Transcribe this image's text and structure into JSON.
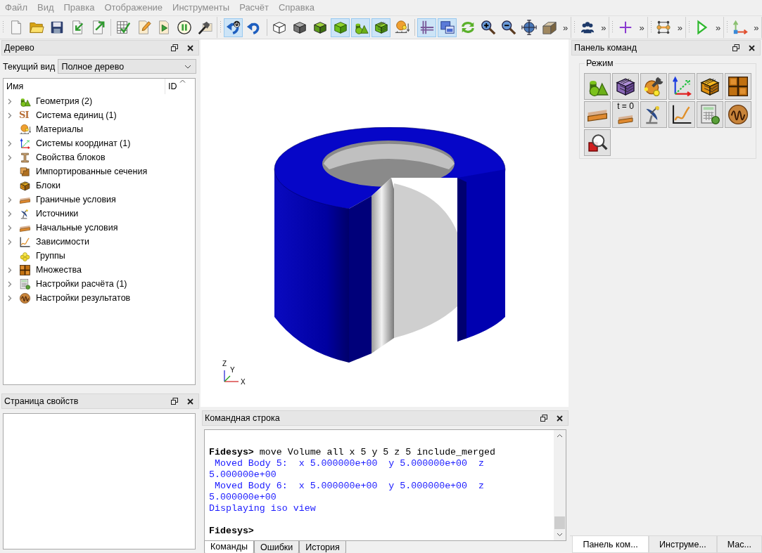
{
  "menu": [
    "Файл",
    "Вид",
    "Правка",
    "Отображение",
    "Инструменты",
    "Расчёт",
    "Справка"
  ],
  "toolbars": [
    {
      "sections": [
        [
          {
            "kind": "new",
            "pressed": false
          },
          {
            "kind": "open",
            "pressed": false
          },
          {
            "kind": "save",
            "pressed": false
          },
          {
            "kind": "import",
            "pressed": false
          },
          {
            "kind": "export",
            "pressed": false
          }
        ],
        [
          {
            "kind": "table",
            "pressed": false
          },
          {
            "kind": "edit",
            "pressed": false
          },
          {
            "kind": "run",
            "pressed": false
          },
          {
            "kind": "pause",
            "pressed": false
          },
          {
            "kind": "hammer",
            "pressed": false
          }
        ]
      ]
    },
    {
      "sections": [
        [
          {
            "kind": "reset",
            "pressed": true
          },
          {
            "kind": "undo",
            "pressed": false
          }
        ],
        [
          {
            "kind": "wireframe",
            "pressed": false
          },
          {
            "kind": "solid",
            "pressed": false
          },
          {
            "kind": "edges",
            "pressed": false
          },
          {
            "kind": "greencube",
            "pressed": true
          },
          {
            "kind": "shapes",
            "pressed": true
          },
          {
            "kind": "mesh",
            "pressed": true
          },
          {
            "kind": "material",
            "pressed": false
          }
        ],
        [
          {
            "kind": "grid",
            "pressed": true
          },
          {
            "kind": "windows",
            "pressed": true
          },
          {
            "kind": "refresh",
            "pressed": false
          },
          {
            "kind": "zoomin",
            "pressed": false
          },
          {
            "kind": "zoomout",
            "pressed": false
          },
          {
            "kind": "center",
            "pressed": false
          },
          {
            "kind": "box",
            "pressed": false
          }
        ]
      ],
      "overflow": "»"
    },
    {
      "sections": [
        [
          {
            "kind": "people",
            "pressed": false
          }
        ]
      ],
      "overflow": "»"
    },
    {
      "sections": [
        [
          {
            "kind": "plus",
            "pressed": false
          }
        ]
      ],
      "overflow": "»"
    },
    {
      "sections": [
        [
          {
            "kind": "nodes",
            "pressed": false
          }
        ]
      ],
      "overflow": "»"
    },
    {
      "sections": [
        [
          {
            "kind": "play",
            "pressed": false
          }
        ]
      ],
      "overflow": "»"
    },
    {
      "sections": [
        [
          {
            "kind": "axes",
            "pressed": false
          }
        ]
      ],
      "overflow": "»"
    }
  ],
  "tree_panel": {
    "title": "Дерево",
    "view_label": "Текущий вид",
    "view_value": "Полное дерево",
    "columns": [
      "Имя",
      "ID"
    ],
    "items": [
      {
        "label": "Геометрия (2)",
        "kind": "shapes",
        "expandable": true
      },
      {
        "label": "Система единиц (1)",
        "kind": "units",
        "icon_text": "SI",
        "expandable": true
      },
      {
        "label": "Материалы",
        "kind": "material",
        "expandable": false
      },
      {
        "label": "Системы координат (1)",
        "kind": "coords",
        "expandable": true
      },
      {
        "label": "Свойства блоков",
        "kind": "beam",
        "expandable": true
      },
      {
        "label": "Импортированные сечения",
        "kind": "section",
        "expandable": false
      },
      {
        "label": "Блоки",
        "kind": "blocks",
        "expandable": false
      },
      {
        "label": "Граничные условия",
        "kind": "strip",
        "expandable": true
      },
      {
        "label": "Источники",
        "kind": "dish",
        "expandable": true
      },
      {
        "label": "Начальные условия",
        "kind": "initial",
        "expandable": true
      },
      {
        "label": "Зависимости",
        "kind": "graph",
        "expandable": true
      },
      {
        "label": "Группы",
        "kind": "groups",
        "expandable": false
      },
      {
        "label": "Множества",
        "kind": "sets",
        "expandable": true
      },
      {
        "label": "Настройки расчёта (1)",
        "kind": "calc",
        "expandable": true
      },
      {
        "label": "Настройки результатов",
        "kind": "results",
        "expandable": true
      }
    ]
  },
  "properties_panel": {
    "title": "Страница свойств"
  },
  "viewport": {
    "triad": {
      "z": "Z",
      "y": "Y",
      "x": "X"
    }
  },
  "command_line": {
    "title": "Командная строка",
    "lines": [
      {
        "kind": "prompt",
        "text": "**Fidesys>** move Volume all x 5 y 5 z 5 include_merged"
      },
      {
        "kind": "output",
        "text": " Moved Body 5:  x 5.000000e+00  y 5.000000e+00  z"
      },
      {
        "kind": "output",
        "text": "5.000000e+00"
      },
      {
        "kind": "output",
        "text": " Moved Body 6:  x 5.000000e+00  y 5.000000e+00  z"
      },
      {
        "kind": "output",
        "text": "5.000000e+00"
      },
      {
        "kind": "output",
        "text": "Displaying iso view"
      },
      {
        "kind": "prompt",
        "text": "**Fidesys>**"
      }
    ],
    "tabs": [
      {
        "label": "Команды",
        "selected": true
      },
      {
        "label": "Ошибки",
        "selected": false
      },
      {
        "label": "История",
        "selected": false
      }
    ]
  },
  "command_panel": {
    "title": "Панель команд",
    "group": "Режим",
    "buttons": [
      {
        "kind": "shapes"
      },
      {
        "kind": "mesh3"
      },
      {
        "kind": "tools"
      },
      {
        "kind": "coords"
      },
      {
        "kind": "blocks"
      },
      {
        "kind": "sets"
      },
      {
        "kind": "strip"
      },
      {
        "kind": "initial",
        "label": "t = 0"
      },
      {
        "kind": "dish"
      },
      {
        "kind": "graph"
      },
      {
        "kind": "calc"
      },
      {
        "kind": "results"
      },
      {
        "kind": "inspect"
      }
    ]
  },
  "right_tabs": [
    {
      "label": "Панель ком...",
      "selected": true
    },
    {
      "label": "Инструме...",
      "selected": false
    },
    {
      "label": "Мас...",
      "selected": false
    }
  ]
}
